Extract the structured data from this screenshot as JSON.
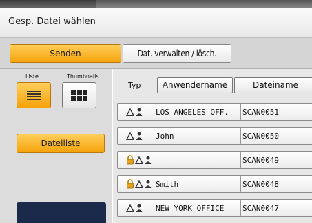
{
  "title": "Gesp. Datei wählen",
  "tabs": {
    "senden_label": "Senden",
    "verwalten_label": "Dat. verwalten / lösch."
  },
  "view": {
    "list_label": "Liste",
    "thumb_label": "Thumbnails"
  },
  "dateiliste_label": "Dateiliste",
  "table": {
    "typ_label": "Typ",
    "columns": [
      "Anwendername",
      "Dateiname"
    ],
    "rows": [
      {
        "icons": [
          "printer-icon",
          "person-icon"
        ],
        "user": "LOS ANGELES OFF.",
        "file": "SCAN0051"
      },
      {
        "icons": [
          "printer-icon",
          "person-icon"
        ],
        "user": "John",
        "file": "SCAN0050"
      },
      {
        "icons": [
          "lock-icon",
          "printer-icon",
          "person-icon"
        ],
        "user": "",
        "file": "SCAN0049"
      },
      {
        "icons": [
          "lock-icon",
          "printer-icon",
          "person-icon"
        ],
        "user": "Smith",
        "file": "SCAN0048"
      },
      {
        "icons": [
          "printer-icon",
          "person-icon"
        ],
        "user": "NEW YORK OFFICE",
        "file": "SCAN0047"
      }
    ]
  },
  "colors": {
    "accent": "#f5a20a",
    "accent_light": "#ffce5a",
    "panel": "#dcdcdc"
  }
}
